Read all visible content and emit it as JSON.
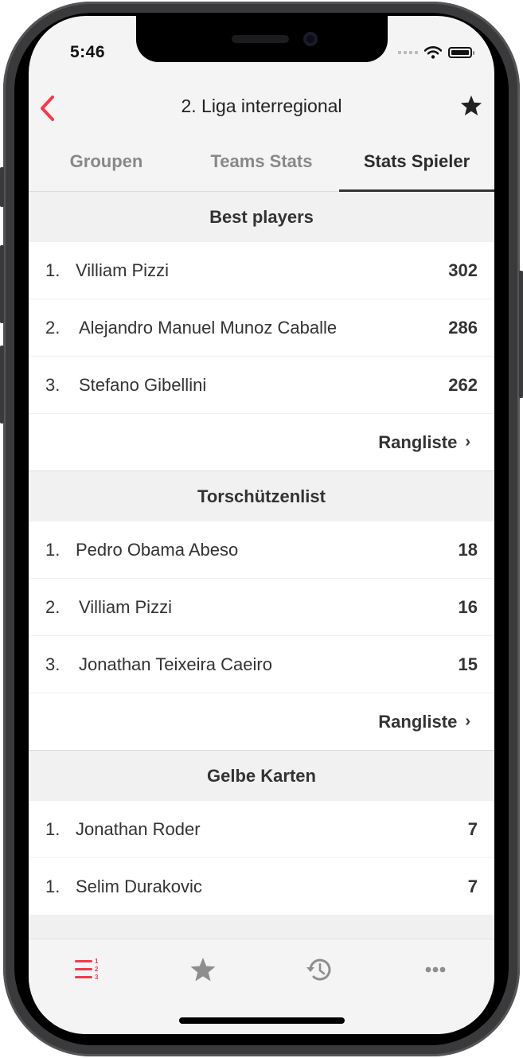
{
  "status_bar": {
    "time": "5:46"
  },
  "navbar": {
    "title": "2. Liga interregional",
    "back_icon": "chevron-left-icon",
    "favorite_icon": "star-icon"
  },
  "tabs": [
    {
      "label": "Groupen",
      "active": false
    },
    {
      "label": "Teams Stats",
      "active": false
    },
    {
      "label": "Stats Spieler",
      "active": true
    }
  ],
  "sections": [
    {
      "title": "Best players",
      "rows": [
        {
          "rank": "1.",
          "name": "Villiam Pizzi",
          "value": "302"
        },
        {
          "rank": "2.",
          "name": "Alejandro Manuel Munoz Caballe",
          "value": "286"
        },
        {
          "rank": "3.",
          "name": "Stefano Gibellini",
          "value": "262"
        }
      ],
      "more_label": "Rangliste"
    },
    {
      "title": "Torschützenlist",
      "rows": [
        {
          "rank": "1.",
          "name": "Pedro Obama Abeso",
          "value": "18"
        },
        {
          "rank": "2.",
          "name": "Villiam Pizzi",
          "value": "16"
        },
        {
          "rank": "3.",
          "name": "Jonathan Teixeira Caeiro",
          "value": "15"
        }
      ],
      "more_label": "Rangliste"
    },
    {
      "title": "Gelbe Karten",
      "rows": [
        {
          "rank": "1.",
          "name": "Jonathan Roder",
          "value": "7"
        },
        {
          "rank": "1.",
          "name": "Selim Durakovic",
          "value": "7"
        }
      ]
    }
  ],
  "tabbar": [
    {
      "icon": "ranking-list-icon",
      "active": true
    },
    {
      "icon": "star-icon",
      "active": false
    },
    {
      "icon": "history-icon",
      "active": false
    },
    {
      "icon": "more-icon",
      "active": false
    }
  ],
  "colors": {
    "accent": "#f5394b",
    "inactive": "#8e8e8e",
    "text": "#333333"
  }
}
